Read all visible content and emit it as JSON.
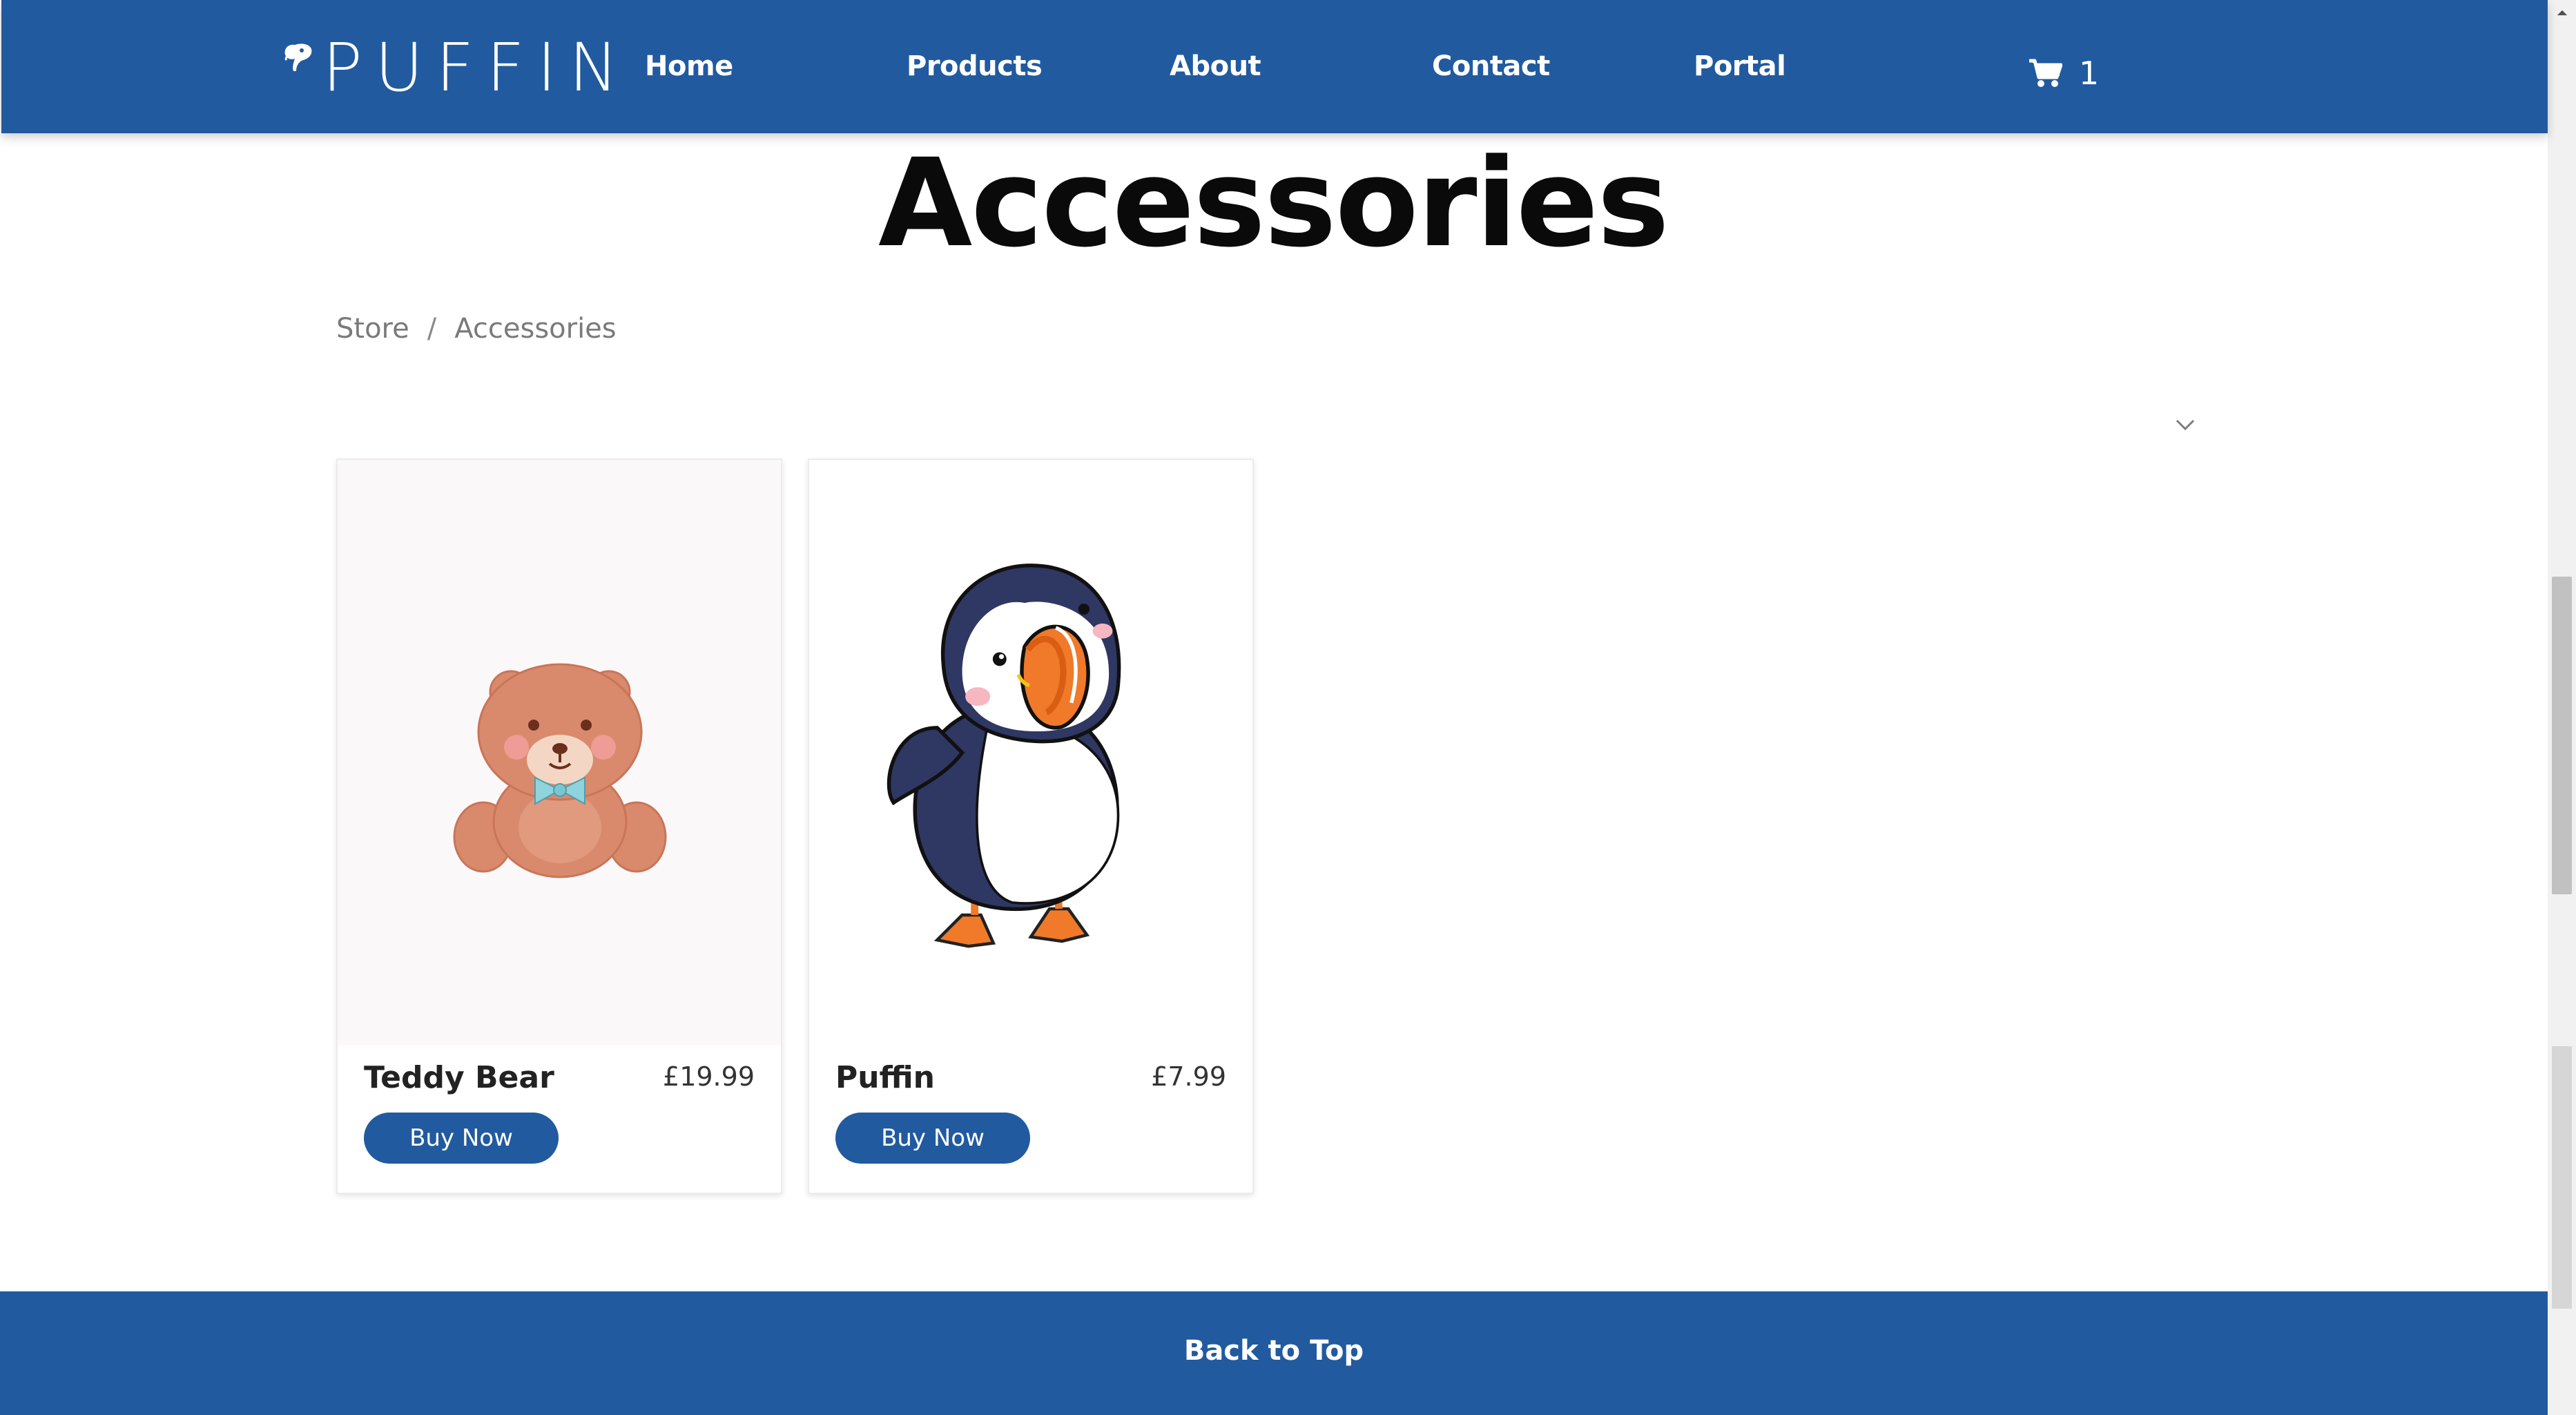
{
  "header": {
    "logo_text": "PUFFIN",
    "nav": [
      "Home",
      "Products",
      "About",
      "Contact",
      "Portal"
    ],
    "cart_count": "1"
  },
  "page": {
    "title": "Accessories",
    "breadcrumb": [
      "Store",
      "Accessories"
    ]
  },
  "products": [
    {
      "name": "Teddy Bear",
      "price": "£19.99",
      "button_label": "Buy Now"
    },
    {
      "name": "Puffin",
      "price": "£7.99",
      "button_label": "Buy Now"
    }
  ],
  "footer": {
    "back_to_top": "Back to Top"
  },
  "colors": {
    "brand_blue": "#215A9F",
    "title": "#0a0a0a",
    "breadcrumb": "#7a7a7a"
  },
  "icons": [
    "puffin-logo-icon",
    "cart-icon",
    "chevron-down-icon",
    "teddy-bear-image",
    "puffin-image"
  ]
}
